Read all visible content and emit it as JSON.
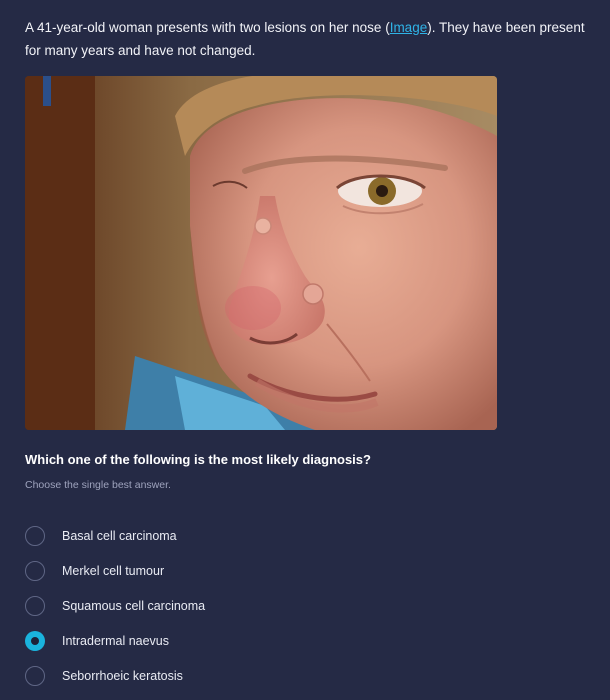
{
  "stem": {
    "text_before": "A 41-year-old woman presents with two lesions on her nose (",
    "link_text": "Image",
    "text_after": "). They have been present for many years and have not changed."
  },
  "image": {
    "description": "Clinical photograph of a woman's face showing two skin-coloured papules on the nose"
  },
  "question": {
    "title": "Which one of the following is the most likely diagnosis?",
    "instruction": "Choose the single best answer."
  },
  "options": [
    {
      "label": "Basal cell carcinoma",
      "selected": false
    },
    {
      "label": "Merkel cell tumour",
      "selected": false
    },
    {
      "label": "Squamous cell carcinoma",
      "selected": false
    },
    {
      "label": "Intradermal naevus",
      "selected": true
    },
    {
      "label": "Seborrhoeic keratosis",
      "selected": false
    }
  ],
  "colors": {
    "background": "#252a45",
    "accent": "#1ab3dd",
    "link": "#2fb3e6"
  }
}
